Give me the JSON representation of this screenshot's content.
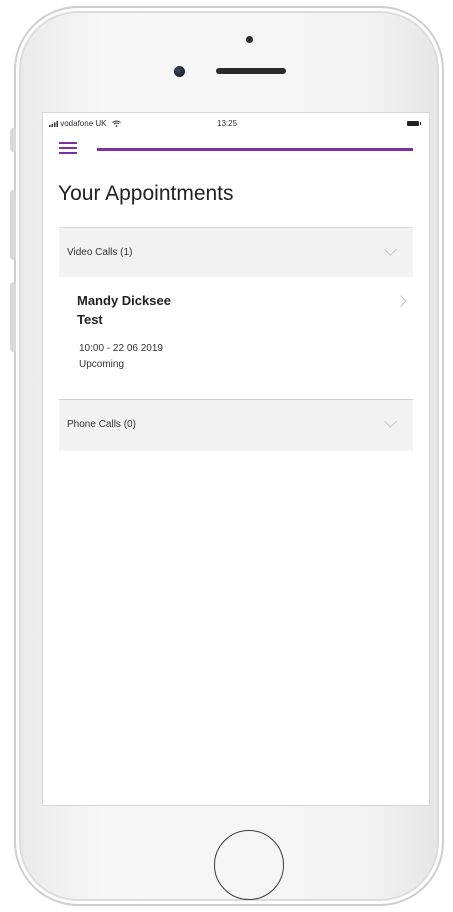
{
  "status_bar": {
    "carrier": "vodafone UK",
    "time": "13:25"
  },
  "app_bar": {
    "accent_color": "#7b2fa0"
  },
  "page": {
    "title": "Your Appointments"
  },
  "sections": {
    "video_calls": {
      "label": "Video Calls (1)",
      "appointments": [
        {
          "name_line1": "Mandy Dicksee",
          "name_line2": "Test",
          "datetime": "10:00 - 22 06 2019",
          "status": "Upcoming"
        }
      ]
    },
    "phone_calls": {
      "label": "Phone Calls (0)"
    }
  },
  "icons": {
    "signal": "signal-icon",
    "wifi": "wifi-icon",
    "battery": "battery-icon",
    "menu": "menu-icon",
    "chevron_down": "chevron-down-icon",
    "chevron_right": "chevron-right-icon"
  }
}
